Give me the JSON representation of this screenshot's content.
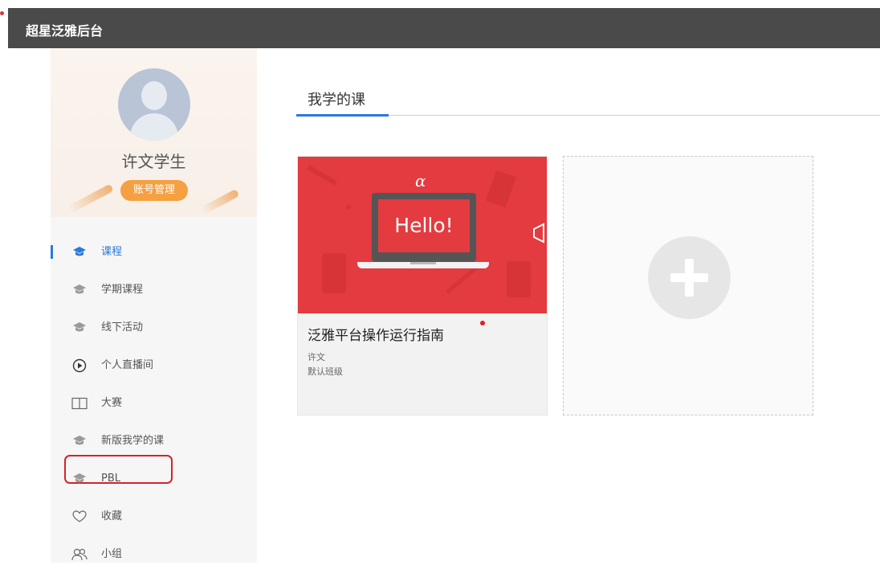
{
  "app": {
    "title": "超星泛雅后台"
  },
  "profile": {
    "name": "许文学生",
    "account_button": "账号管理"
  },
  "nav": {
    "items": [
      {
        "label": "课程",
        "icon": "graduation-cap-icon",
        "active": true
      },
      {
        "label": "学期课程",
        "icon": "graduation-cap-icon"
      },
      {
        "label": "线下活动",
        "icon": "graduation-cap-icon"
      },
      {
        "label": "个人直播间",
        "icon": "play-circle-icon"
      },
      {
        "label": "大赛",
        "icon": "book-open-icon"
      },
      {
        "label": "新版我学的课",
        "icon": "graduation-cap-icon"
      },
      {
        "label": "PBL",
        "icon": "graduation-cap-icon",
        "highlighted": true
      },
      {
        "label": "收藏",
        "icon": "heart-icon"
      },
      {
        "label": "小组",
        "icon": "group-icon"
      }
    ]
  },
  "main": {
    "tab_label": "我学的课",
    "course": {
      "cover_text": "Hello!",
      "cover_symbol": "α",
      "title": "泛雅平台操作运行指南",
      "teacher": "许文",
      "class": "默认班级"
    },
    "add_card": {
      "icon": "plus-icon"
    }
  },
  "colors": {
    "topbar": "#4a4a4a",
    "accent": "#2b7ad9",
    "cover_red": "#e33b3f",
    "account_button": "#f5a041",
    "highlight_border": "#d4232b"
  }
}
